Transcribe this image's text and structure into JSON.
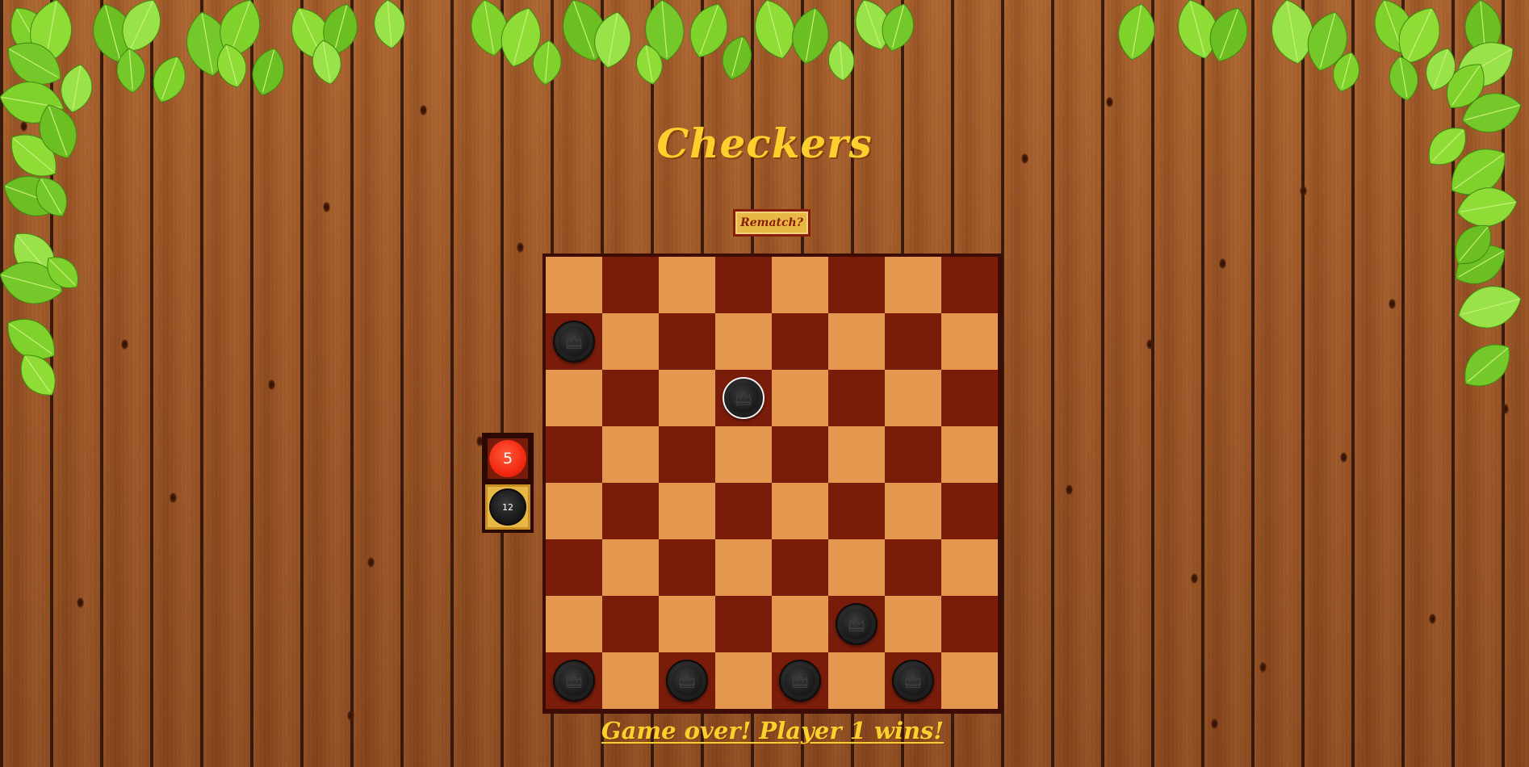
{
  "game": {
    "title": "Checkers",
    "rematch_label": "Rematch?",
    "status_message": "Game over! Player 1 wins!"
  },
  "score": {
    "red_count": "5",
    "black_count": "12"
  },
  "colors": {
    "title": "#ffcf2e",
    "board_light": "#e4974f",
    "board_dark": "#7a1c0a",
    "red_piece": "#f22a12",
    "black_piece": "#1a1a1a"
  },
  "board": {
    "size": 8,
    "pieces": [
      {
        "row": 1,
        "col": 0,
        "color": "black",
        "king": true,
        "selected": false
      },
      {
        "row": 2,
        "col": 3,
        "color": "black",
        "king": true,
        "selected": true
      },
      {
        "row": 6,
        "col": 5,
        "color": "black",
        "king": false,
        "selected": false
      },
      {
        "row": 7,
        "col": 0,
        "color": "black",
        "king": false,
        "selected": false
      },
      {
        "row": 7,
        "col": 2,
        "color": "black",
        "king": false,
        "selected": false
      },
      {
        "row": 7,
        "col": 4,
        "color": "black",
        "king": false,
        "selected": false
      },
      {
        "row": 7,
        "col": 6,
        "color": "black",
        "king": false,
        "selected": false
      }
    ]
  }
}
